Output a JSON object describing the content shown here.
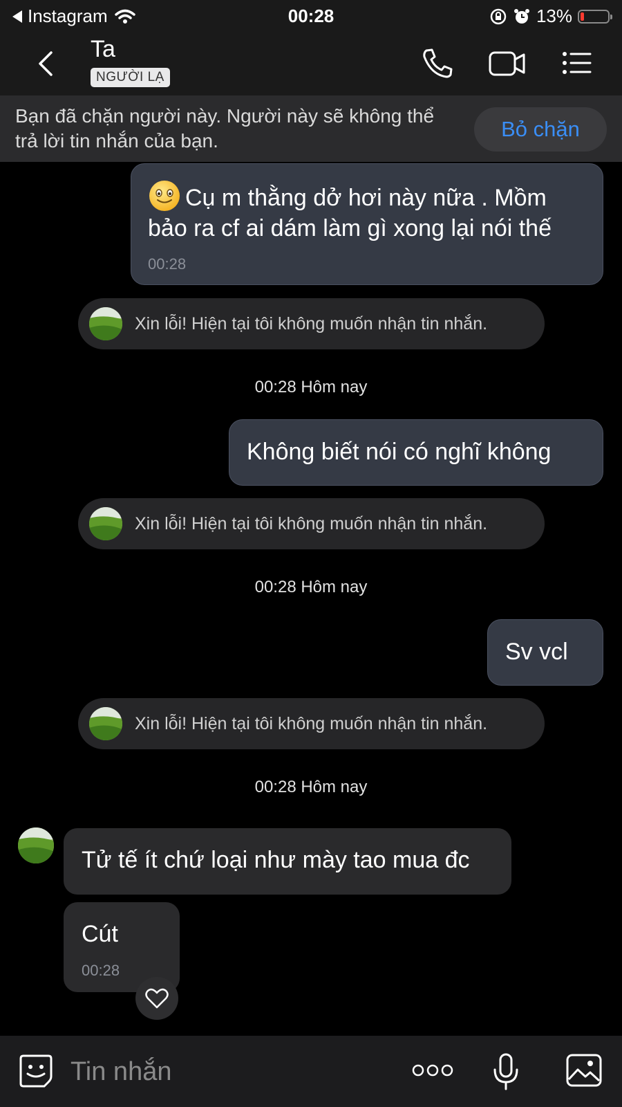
{
  "status_bar": {
    "back_app": "Instagram",
    "time": "00:28",
    "battery_percent": "13%",
    "battery_level": 0.13
  },
  "header": {
    "contact_name": "Ta",
    "badge": "NGƯỜI LẠ"
  },
  "block_banner": {
    "text": "Bạn đã chặn người này. Người này sẽ không thể trả lời tin nhắn của bạn.",
    "unblock_label": "Bỏ chặn"
  },
  "messages": [
    {
      "type": "outgoing",
      "emoji": "🙂",
      "text": "Cụ m thằng dở hơi này nữa . Mồm bảo ra cf ai dám làm gì xong lại nói thế",
      "time": "00:28"
    },
    {
      "type": "autoreply",
      "text": "Xin lỗi! Hiện tại tôi không muốn nhận tin nhắn."
    },
    {
      "type": "timestamp",
      "text": "00:28 Hôm nay"
    },
    {
      "type": "outgoing",
      "text": "Không biết nói có nghĩ không"
    },
    {
      "type": "autoreply",
      "text": "Xin lỗi! Hiện tại tôi không muốn nhận tin nhắn."
    },
    {
      "type": "timestamp",
      "text": "00:28 Hôm nay"
    },
    {
      "type": "outgoing",
      "text": "Sv vcl"
    },
    {
      "type": "autoreply",
      "text": "Xin lỗi! Hiện tại tôi không muốn nhận tin nhắn."
    },
    {
      "type": "timestamp",
      "text": "00:28 Hôm nay"
    },
    {
      "type": "incoming",
      "text": "Tử tế ít chứ loại như mày tao mua đc"
    },
    {
      "type": "incoming",
      "text": "Cút",
      "time": "00:28"
    }
  ],
  "composer": {
    "placeholder": "Tin nhắn"
  },
  "colors": {
    "accent": "#3a8ef6",
    "outgoing_bubble": "#353a45",
    "incoming_bubble": "#2a2a2c",
    "battery_low": "#ff3b30"
  }
}
